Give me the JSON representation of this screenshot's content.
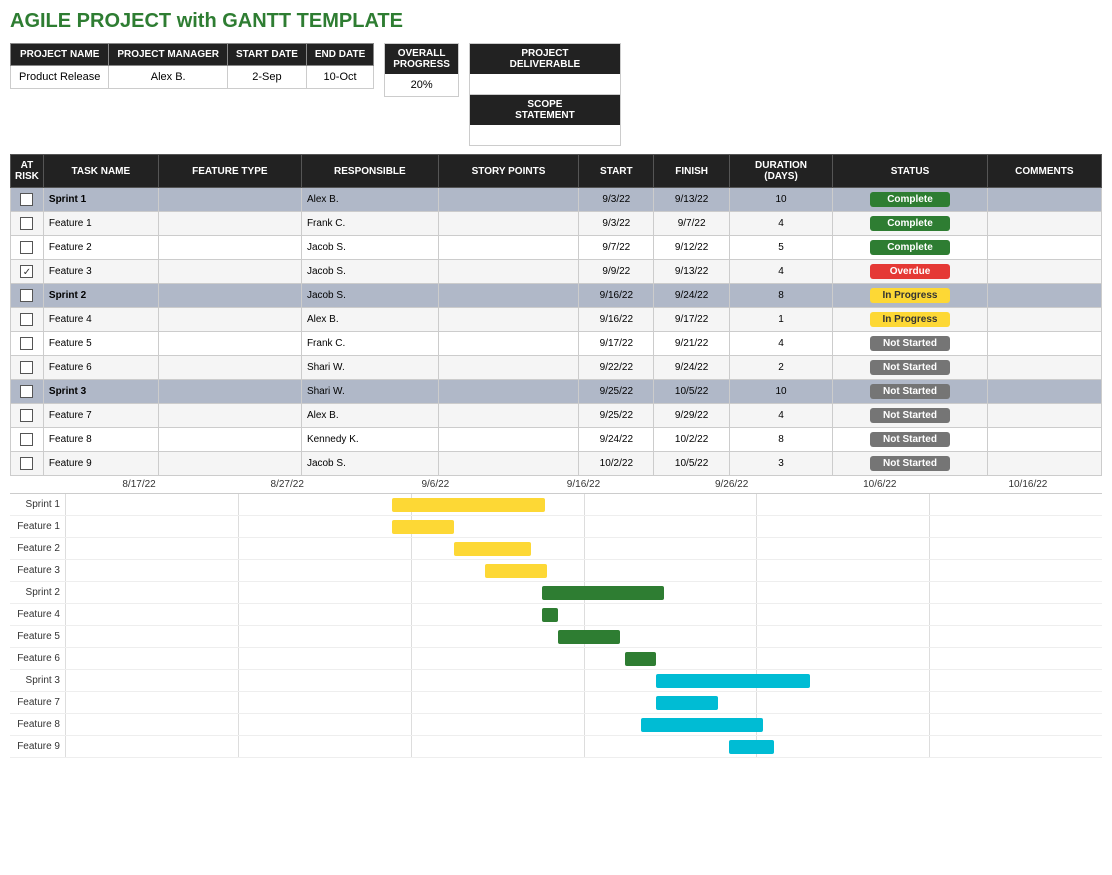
{
  "title": "AGILE PROJECT with GANTT TEMPLATE",
  "header": {
    "project_name_label": "PROJECT NAME",
    "project_manager_label": "PROJECT MANAGER",
    "start_date_label": "START DATE",
    "end_date_label": "END DATE",
    "project_name_value": "Product Release",
    "project_manager_value": "Alex B.",
    "start_date_value": "2-Sep",
    "end_date_value": "10-Oct",
    "overall_progress_label": "OVERALL\nPROGRESS",
    "overall_progress_value": "20%",
    "project_deliverable_label": "PROJECT\nDELIVERABLE",
    "project_deliverable_value": "",
    "scope_statement_label": "SCOPE\nSTATEMENT",
    "scope_statement_value": ""
  },
  "table": {
    "columns": [
      "AT\nRISK",
      "TASK NAME",
      "FEATURE TYPE",
      "RESPONSIBLE",
      "STORY POINTS",
      "START",
      "FINISH",
      "DURATION\n(DAYS)",
      "STATUS",
      "COMMENTS"
    ],
    "rows": [
      {
        "at_risk": false,
        "checked": false,
        "task_name": "Sprint 1",
        "feature_type": "",
        "responsible": "Alex B.",
        "story_points": "",
        "start": "9/3/22",
        "finish": "9/13/22",
        "duration": "10",
        "status": "Complete",
        "status_class": "status-complete",
        "comments": "",
        "is_sprint": true
      },
      {
        "at_risk": false,
        "checked": false,
        "task_name": "Feature 1",
        "feature_type": "",
        "responsible": "Frank C.",
        "story_points": "",
        "start": "9/3/22",
        "finish": "9/7/22",
        "duration": "4",
        "status": "Complete",
        "status_class": "status-complete",
        "comments": "",
        "is_sprint": false
      },
      {
        "at_risk": false,
        "checked": false,
        "task_name": "Feature 2",
        "feature_type": "",
        "responsible": "Jacob S.",
        "story_points": "",
        "start": "9/7/22",
        "finish": "9/12/22",
        "duration": "5",
        "status": "Complete",
        "status_class": "status-complete",
        "comments": "",
        "is_sprint": false
      },
      {
        "at_risk": true,
        "checked": true,
        "task_name": "Feature 3",
        "feature_type": "",
        "responsible": "Jacob S.",
        "story_points": "",
        "start": "9/9/22",
        "finish": "9/13/22",
        "duration": "4",
        "status": "Overdue",
        "status_class": "status-overdue",
        "comments": "",
        "is_sprint": false
      },
      {
        "at_risk": false,
        "checked": false,
        "task_name": "Sprint 2",
        "feature_type": "",
        "responsible": "Jacob S.",
        "story_points": "",
        "start": "9/16/22",
        "finish": "9/24/22",
        "duration": "8",
        "status": "In Progress",
        "status_class": "status-inprogress",
        "comments": "",
        "is_sprint": true
      },
      {
        "at_risk": false,
        "checked": false,
        "task_name": "Feature 4",
        "feature_type": "",
        "responsible": "Alex B.",
        "story_points": "",
        "start": "9/16/22",
        "finish": "9/17/22",
        "duration": "1",
        "status": "In Progress",
        "status_class": "status-inprogress",
        "comments": "",
        "is_sprint": false
      },
      {
        "at_risk": false,
        "checked": false,
        "task_name": "Feature 5",
        "feature_type": "",
        "responsible": "Frank C.",
        "story_points": "",
        "start": "9/17/22",
        "finish": "9/21/22",
        "duration": "4",
        "status": "Not Started",
        "status_class": "status-notstarted",
        "comments": "",
        "is_sprint": false
      },
      {
        "at_risk": false,
        "checked": false,
        "task_name": "Feature 6",
        "feature_type": "",
        "responsible": "Shari W.",
        "story_points": "",
        "start": "9/22/22",
        "finish": "9/24/22",
        "duration": "2",
        "status": "Not Started",
        "status_class": "status-notstarted",
        "comments": "",
        "is_sprint": false
      },
      {
        "at_risk": false,
        "checked": false,
        "task_name": "Sprint 3",
        "feature_type": "",
        "responsible": "Shari W.",
        "story_points": "",
        "start": "9/25/22",
        "finish": "10/5/22",
        "duration": "10",
        "status": "Not Started",
        "status_class": "status-notstarted",
        "comments": "",
        "is_sprint": true
      },
      {
        "at_risk": false,
        "checked": false,
        "task_name": "Feature 7",
        "feature_type": "",
        "responsible": "Alex B.",
        "story_points": "",
        "start": "9/25/22",
        "finish": "9/29/22",
        "duration": "4",
        "status": "Not Started",
        "status_class": "status-notstarted",
        "comments": "",
        "is_sprint": false
      },
      {
        "at_risk": false,
        "checked": false,
        "task_name": "Feature 8",
        "feature_type": "",
        "responsible": "Kennedy K.",
        "story_points": "",
        "start": "9/24/22",
        "finish": "10/2/22",
        "duration": "8",
        "status": "Not Started",
        "status_class": "status-notstarted",
        "comments": "",
        "is_sprint": false
      },
      {
        "at_risk": false,
        "checked": false,
        "task_name": "Feature 9",
        "feature_type": "",
        "responsible": "Jacob S.",
        "story_points": "",
        "start": "10/2/22",
        "finish": "10/5/22",
        "duration": "3",
        "status": "Not Started",
        "status_class": "status-notstarted",
        "comments": "",
        "is_sprint": false
      }
    ]
  },
  "gantt": {
    "date_labels": [
      "8/17/22",
      "8/27/22",
      "9/6/22",
      "9/16/22",
      "9/26/22",
      "10/6/22",
      "10/16/22"
    ],
    "row_labels": [
      "Sprint 1",
      "Feature 1",
      "Feature 2",
      "Feature 3",
      "Sprint 2",
      "Feature 4",
      "Feature 5",
      "Feature 6",
      "Sprint 3",
      "Feature 7",
      "Feature 8",
      "Feature 9"
    ],
    "bars": [
      {
        "label": "Sprint 1",
        "left_pct": 31.5,
        "width_pct": 14.8,
        "color": "#fdd835"
      },
      {
        "label": "Feature 1",
        "left_pct": 31.5,
        "width_pct": 6.0,
        "color": "#fdd835"
      },
      {
        "label": "Feature 2",
        "left_pct": 37.5,
        "width_pct": 7.4,
        "color": "#fdd835"
      },
      {
        "label": "Feature 3",
        "left_pct": 40.5,
        "width_pct": 6.0,
        "color": "#fdd835"
      },
      {
        "label": "Sprint 2",
        "left_pct": 46.0,
        "width_pct": 11.8,
        "color": "#2e7d32"
      },
      {
        "label": "Feature 4",
        "left_pct": 46.0,
        "width_pct": 1.5,
        "color": "#2e7d32"
      },
      {
        "label": "Feature 5",
        "left_pct": 47.5,
        "width_pct": 6.0,
        "color": "#2e7d32"
      },
      {
        "label": "Feature 6",
        "left_pct": 54.0,
        "width_pct": 3.0,
        "color": "#2e7d32"
      },
      {
        "label": "Sprint 3",
        "left_pct": 57.0,
        "width_pct": 14.8,
        "color": "#00bcd4"
      },
      {
        "label": "Feature 7",
        "left_pct": 57.0,
        "width_pct": 6.0,
        "color": "#00bcd4"
      },
      {
        "label": "Feature 8",
        "left_pct": 55.5,
        "width_pct": 11.8,
        "color": "#00bcd4"
      },
      {
        "label": "Feature 9",
        "left_pct": 64.0,
        "width_pct": 4.4,
        "color": "#00bcd4"
      }
    ]
  }
}
